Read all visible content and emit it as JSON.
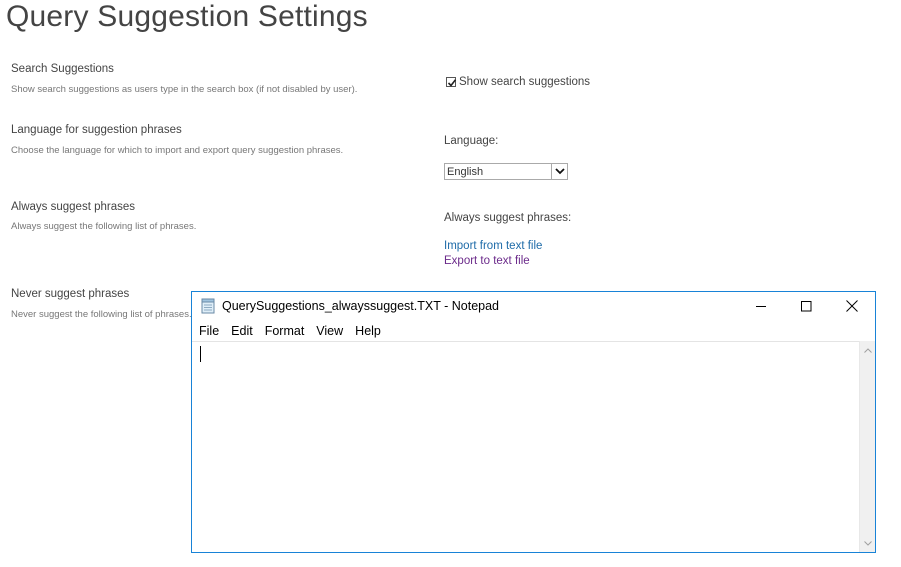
{
  "page": {
    "title": "Query Suggestion Settings"
  },
  "sections": {
    "search_suggestions": {
      "title": "Search Suggestions",
      "description": "Show search suggestions as users type in the search box (if not disabled by user).",
      "checkbox_label": "Show search suggestions",
      "checked": true
    },
    "language": {
      "title": "Language for suggestion phrases",
      "description": "Choose the language for which to import and export query suggestion phrases.",
      "field_label": "Language:",
      "selected": "English"
    },
    "always_suggest": {
      "title": "Always suggest phrases",
      "description": "Always suggest the following list of phrases.",
      "field_label": "Always suggest phrases:",
      "import_link": "Import from text file",
      "export_link": "Export to text file"
    },
    "never_suggest": {
      "title": "Never suggest phrases",
      "description": "Never suggest the following list of phrases."
    }
  },
  "notepad": {
    "title": "QuerySuggestions_alwayssuggest.TXT - Notepad",
    "menu": [
      "File",
      "Edit",
      "Format",
      "View",
      "Help"
    ],
    "content": ""
  },
  "colors": {
    "link": "#1e6ba8",
    "visited_link": "#6b2a8a",
    "window_border": "#1883d7"
  },
  "icons": {
    "notepad": "notepad-icon",
    "minimize": "minimize-icon",
    "maximize": "maximize-icon",
    "close": "close-icon",
    "dropdown": "chevron-down-icon",
    "checkmark": "checkmark-icon"
  }
}
